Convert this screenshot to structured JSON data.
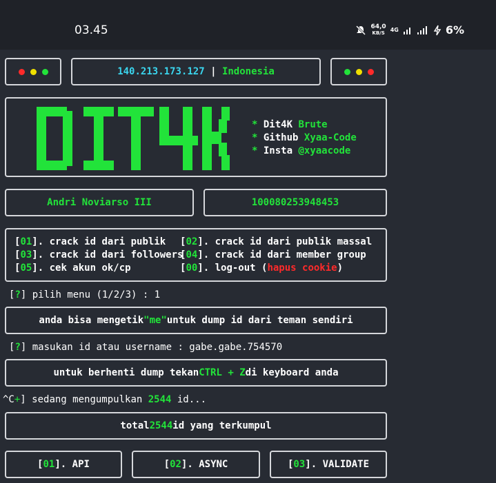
{
  "status_bar": {
    "time": "03.45",
    "net_speed_value": "64,0",
    "net_speed_unit": "KB/S",
    "net_type": "4G",
    "battery": "6%",
    "icons": [
      "mute-icon",
      "signal-icon",
      "signal-icon",
      "charging-icon"
    ]
  },
  "header": {
    "ip": "140.213.173.127",
    "separator": "|",
    "country": "Indonesia",
    "dot_colors_left": [
      "#ff2a2a",
      "#f0e000",
      "#22e33a"
    ],
    "dot_colors_right": [
      "#22e33a",
      "#f0e000",
      "#ff2a2a"
    ]
  },
  "banner": {
    "logo_text": "DIT4K",
    "info": [
      {
        "key": "Dit4K",
        "value": "Brute"
      },
      {
        "key": "Github",
        "value": "Xyaa-Code"
      },
      {
        "key": "Insta",
        "value": "@xyaacode"
      }
    ]
  },
  "account": {
    "name": "Andri Noviarso III",
    "id": "100080253948453"
  },
  "menu": {
    "items": [
      {
        "num": "01",
        "label": "crack id dari publik"
      },
      {
        "num": "02",
        "label": "crack id dari publik massal"
      },
      {
        "num": "03",
        "label": "crack id dari followers"
      },
      {
        "num": "04",
        "label": "crack id dari member group"
      },
      {
        "num": "05",
        "label": "cek akun ok/cp"
      },
      {
        "num": "00",
        "label_prefix": "log-out (",
        "label_red": "hapus cookie",
        "label_suffix": ")"
      }
    ]
  },
  "prompt1": {
    "mark": "?",
    "text": "pilih menu (1/2/3) : 1"
  },
  "hint_dump": {
    "pre": "anda bisa mengetik ",
    "highlight": "\"me\"",
    "post": " untuk dump id dari teman sendiri"
  },
  "prompt2": {
    "mark": "?",
    "text": "masukan id atau username : gabe.gabe.754570"
  },
  "hint_stop": {
    "pre": "untuk berhenti dump tekan ",
    "highlight": "CTRL + Z",
    "post": " di keyboard anda"
  },
  "collecting": {
    "ctrl": "^C",
    "mark": "+",
    "pre": "sedang mengumpulkan ",
    "count": "2544",
    "post": " id..."
  },
  "total": {
    "pre": "total ",
    "count": "2544",
    "post": " id yang terkumpul"
  },
  "methods": [
    {
      "num": "01",
      "label": "API"
    },
    {
      "num": "02",
      "label": "ASYNC"
    },
    {
      "num": "03",
      "label": "VALIDATE"
    }
  ]
}
